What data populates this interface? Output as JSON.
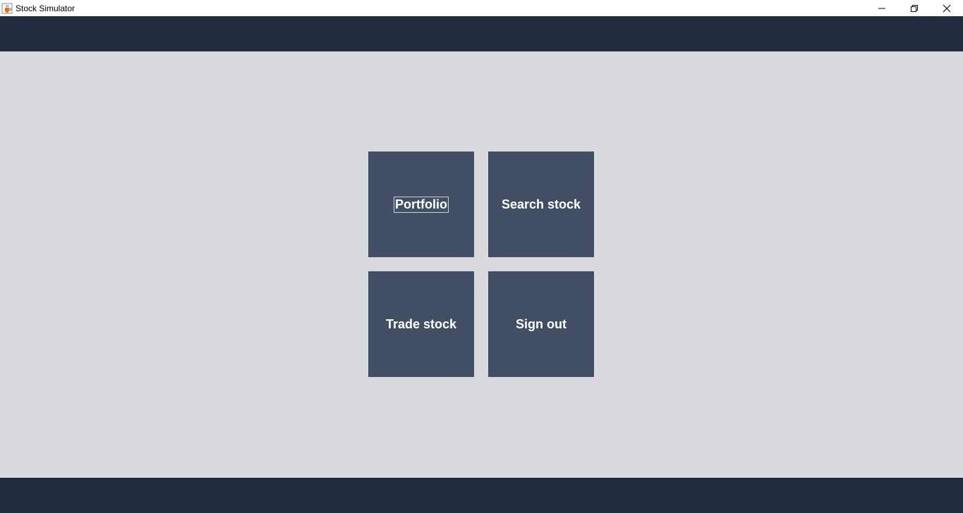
{
  "window": {
    "title": "Stock Simulator",
    "app_icon": "java-cup-icon",
    "controls": [
      "minimize-icon",
      "restore-icon",
      "close-icon"
    ]
  },
  "menu": {
    "tiles": [
      {
        "label": "Portfolio",
        "focused": true
      },
      {
        "label": "Search stock",
        "focused": false
      },
      {
        "label": "Trade stock",
        "focused": false
      },
      {
        "label": "Sign out",
        "focused": false
      }
    ]
  },
  "colors": {
    "background": "#d9dadf",
    "bar": "#232b3e",
    "tile": "#414e64",
    "tile_text": "#ffffff"
  }
}
